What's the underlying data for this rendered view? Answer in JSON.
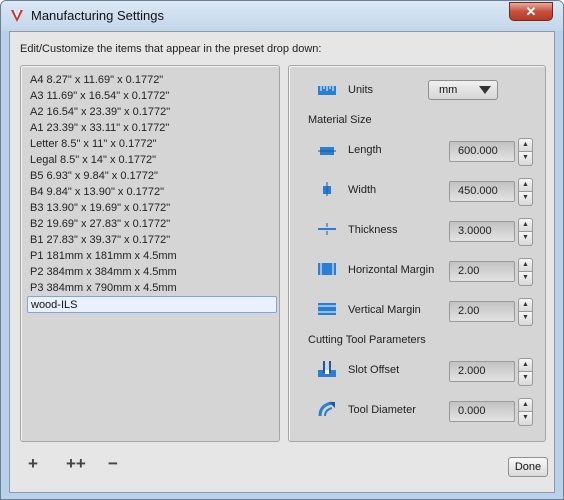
{
  "window": {
    "title": "Manufacturing Settings",
    "close_glyph": "✕",
    "icon": "app-logo-icon"
  },
  "instruction": "Edit/Customize the items that appear in the preset drop down:",
  "presets": [
    {
      "label": "A4 8.27\" x 11.69\" x 0.1772\""
    },
    {
      "label": "A3 11.69\" x 16.54\" x 0.1772\""
    },
    {
      "label": "A2 16.54\" x 23.39\" x 0.1772\""
    },
    {
      "label": "A1 23.39\" x 33.11\" x 0.1772\""
    },
    {
      "label": "Letter 8.5\" x 11\" x 0.1772\""
    },
    {
      "label": "Legal 8.5\" x 14\" x 0.1772\""
    },
    {
      "label": "B5 6.93\" x 9.84\" x 0.1772\""
    },
    {
      "label": "B4 9.84\" x 13.90\" x 0.1772\""
    },
    {
      "label": "B3 13.90\" x 19.69\" x 0.1772\""
    },
    {
      "label": "B2 19.69\" x 27.83\" x 0.1772\""
    },
    {
      "label": "B1 27.83\" x 39.37\" x 0.1772\""
    },
    {
      "label": "P1 181mm x 181mm x 4.5mm"
    },
    {
      "label": "P2 384mm x 384mm x 4.5mm"
    },
    {
      "label": "P3 384mm x 790mm x 4.5mm"
    },
    {
      "label": "wood-ILS",
      "selected": true
    }
  ],
  "units": {
    "label": "Units",
    "value": "mm",
    "icon": "ruler-icon"
  },
  "material_size": {
    "title": "Material Size",
    "length": {
      "label": "Length",
      "value": "600.000",
      "icon": "length-icon"
    },
    "width": {
      "label": "Width",
      "value": "450.000",
      "icon": "width-icon"
    },
    "thickness": {
      "label": "Thickness",
      "value": "3.0000",
      "icon": "thickness-icon"
    },
    "horizontal_margin": {
      "label": "Horizontal Margin",
      "value": "2.00",
      "icon": "horizontal-margin-icon"
    },
    "vertical_margin": {
      "label": "Vertical Margin",
      "value": "2.00",
      "icon": "vertical-margin-icon"
    }
  },
  "cutting_tool": {
    "title": "Cutting Tool Parameters",
    "slot_offset": {
      "label": "Slot Offset",
      "value": "2.000",
      "icon": "slot-offset-icon"
    },
    "tool_diameter": {
      "label": "Tool Diameter",
      "value": "0.000",
      "icon": "tool-diameter-icon"
    }
  },
  "toolbar": {
    "add_glyph": "+",
    "duplicate_glyph": "++",
    "remove_glyph": "−",
    "done_label": "Done"
  },
  "stepper": {
    "up_glyph": "▲",
    "down_glyph": "▼"
  },
  "colors": {
    "accent_blue": "#2a7fd4",
    "selection_border": "#7ea6db",
    "close_red": "#c7503c"
  }
}
